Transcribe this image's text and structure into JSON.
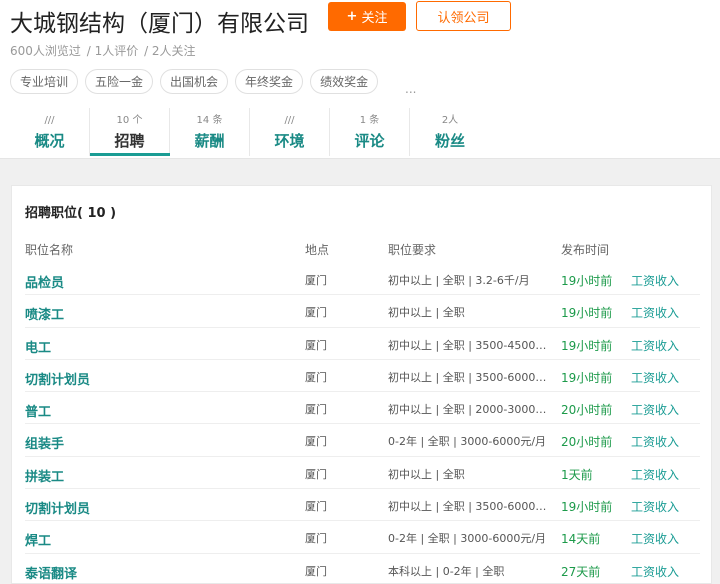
{
  "company": {
    "name": "大城钢结构（厦门）有限公司",
    "follow_label": "关注",
    "follow_plus": "+",
    "claim_label": "认领公司"
  },
  "stats": {
    "views": "600人浏览过",
    "reviews": "/ 1人评价",
    "followers": "/ 2人关注"
  },
  "tags": [
    "专业培训",
    "五险一金",
    "出国机会",
    "年终奖金",
    "绩效奖金"
  ],
  "tags_more": "...",
  "tabs": [
    {
      "count": "///",
      "label": "概况"
    },
    {
      "count": "10 个",
      "label": "招聘"
    },
    {
      "count": "14 条",
      "label": "薪酬"
    },
    {
      "count": "///",
      "label": "环境"
    },
    {
      "count": "1 条",
      "label": "评论"
    },
    {
      "count": "2人",
      "label": "粉丝"
    }
  ],
  "panel": {
    "title": "招聘职位(  10  )",
    "headers": {
      "name": "职位名称",
      "location": "地点",
      "requirement": "职位要求",
      "time": "发布时间"
    },
    "rows": [
      {
        "name": "品检员",
        "location": "厦门",
        "requirement": "初中以上 | 全职 | 3.2-6千/月",
        "time": "19小时前",
        "salary": "工资收入"
      },
      {
        "name": "喷漆工",
        "location": "厦门",
        "requirement": "初中以上 | 全职",
        "time": "19小时前",
        "salary": "工资收入"
      },
      {
        "name": "电工",
        "location": "厦门",
        "requirement": "初中以上 | 全职 | 3500-4500元/...",
        "time": "19小时前",
        "salary": "工资收入"
      },
      {
        "name": "切割计划员",
        "location": "厦门",
        "requirement": "初中以上 | 全职 | 3500-6000元/...",
        "time": "19小时前",
        "salary": "工资收入"
      },
      {
        "name": "普工",
        "location": "厦门",
        "requirement": "初中以上 | 全职 | 2000-3000元/...",
        "time": "20小时前",
        "salary": "工资收入"
      },
      {
        "name": "组装手",
        "location": "厦门",
        "requirement": "0-2年 | 全职 | 3000-6000元/月",
        "time": "20小时前",
        "salary": "工资收入"
      },
      {
        "name": "拼装工",
        "location": "厦门",
        "requirement": "初中以上 | 全职",
        "time": "1天前",
        "salary": "工资收入"
      },
      {
        "name": "切割计划员",
        "location": "厦门",
        "requirement": "初中以上 | 全职 | 3500-6000元/...",
        "time": "19小时前",
        "salary": "工资收入"
      },
      {
        "name": "焊工",
        "location": "厦门",
        "requirement": "0-2年 | 全职 | 3000-6000元/月",
        "time": "14天前",
        "salary": "工资收入"
      },
      {
        "name": "泰语翻译",
        "location": "厦门",
        "requirement": "本科以上 | 0-2年 | 全职",
        "time": "27天前",
        "salary": "工资收入"
      }
    ]
  },
  "colors": {
    "accent": "#ff6a00",
    "link": "#1a8a85",
    "time": "#1c9a4a"
  }
}
